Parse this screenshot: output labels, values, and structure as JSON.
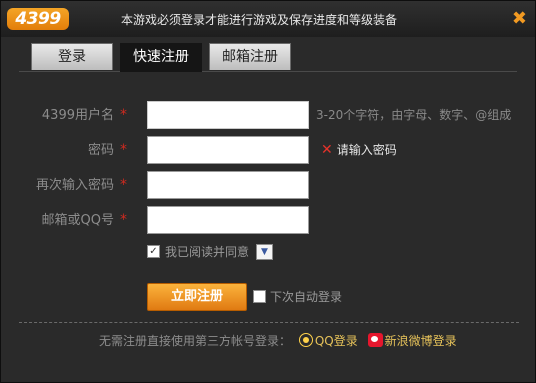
{
  "header": {
    "logo": "4399",
    "title": "本游戏必须登录才能进行游戏及保存进度和等级装备",
    "close": "✖"
  },
  "tabs": [
    {
      "label": "登录",
      "active": false
    },
    {
      "label": "快速注册",
      "active": true
    },
    {
      "label": "邮箱注册",
      "active": false
    }
  ],
  "form": {
    "username": {
      "label": "4399用户名",
      "required": "*",
      "value": "",
      "hint": "3-20个字符，由字母、数字、@组成"
    },
    "password": {
      "label": "密码",
      "required": "*",
      "value": "",
      "error": "请输入密码",
      "error_icon": "✕"
    },
    "confirm": {
      "label": "再次输入密码",
      "required": "*",
      "value": ""
    },
    "email": {
      "label": "邮箱或QQ号",
      "required": "*",
      "value": ""
    },
    "agree": {
      "label": "我已阅读并同意",
      "checked": true,
      "check_mark": "✓",
      "dropdown": "▼"
    },
    "submit": "立即注册",
    "auto_login": {
      "label": "下次自动登录",
      "checked": false
    }
  },
  "third_party": {
    "text": "无需注册直接使用第三方帐号登录：",
    "qq": "QQ登录",
    "weibo": "新浪微博登录"
  },
  "colors": {
    "accent": "#f29a22",
    "error": "#e5322a",
    "link": "#e6c25a"
  }
}
